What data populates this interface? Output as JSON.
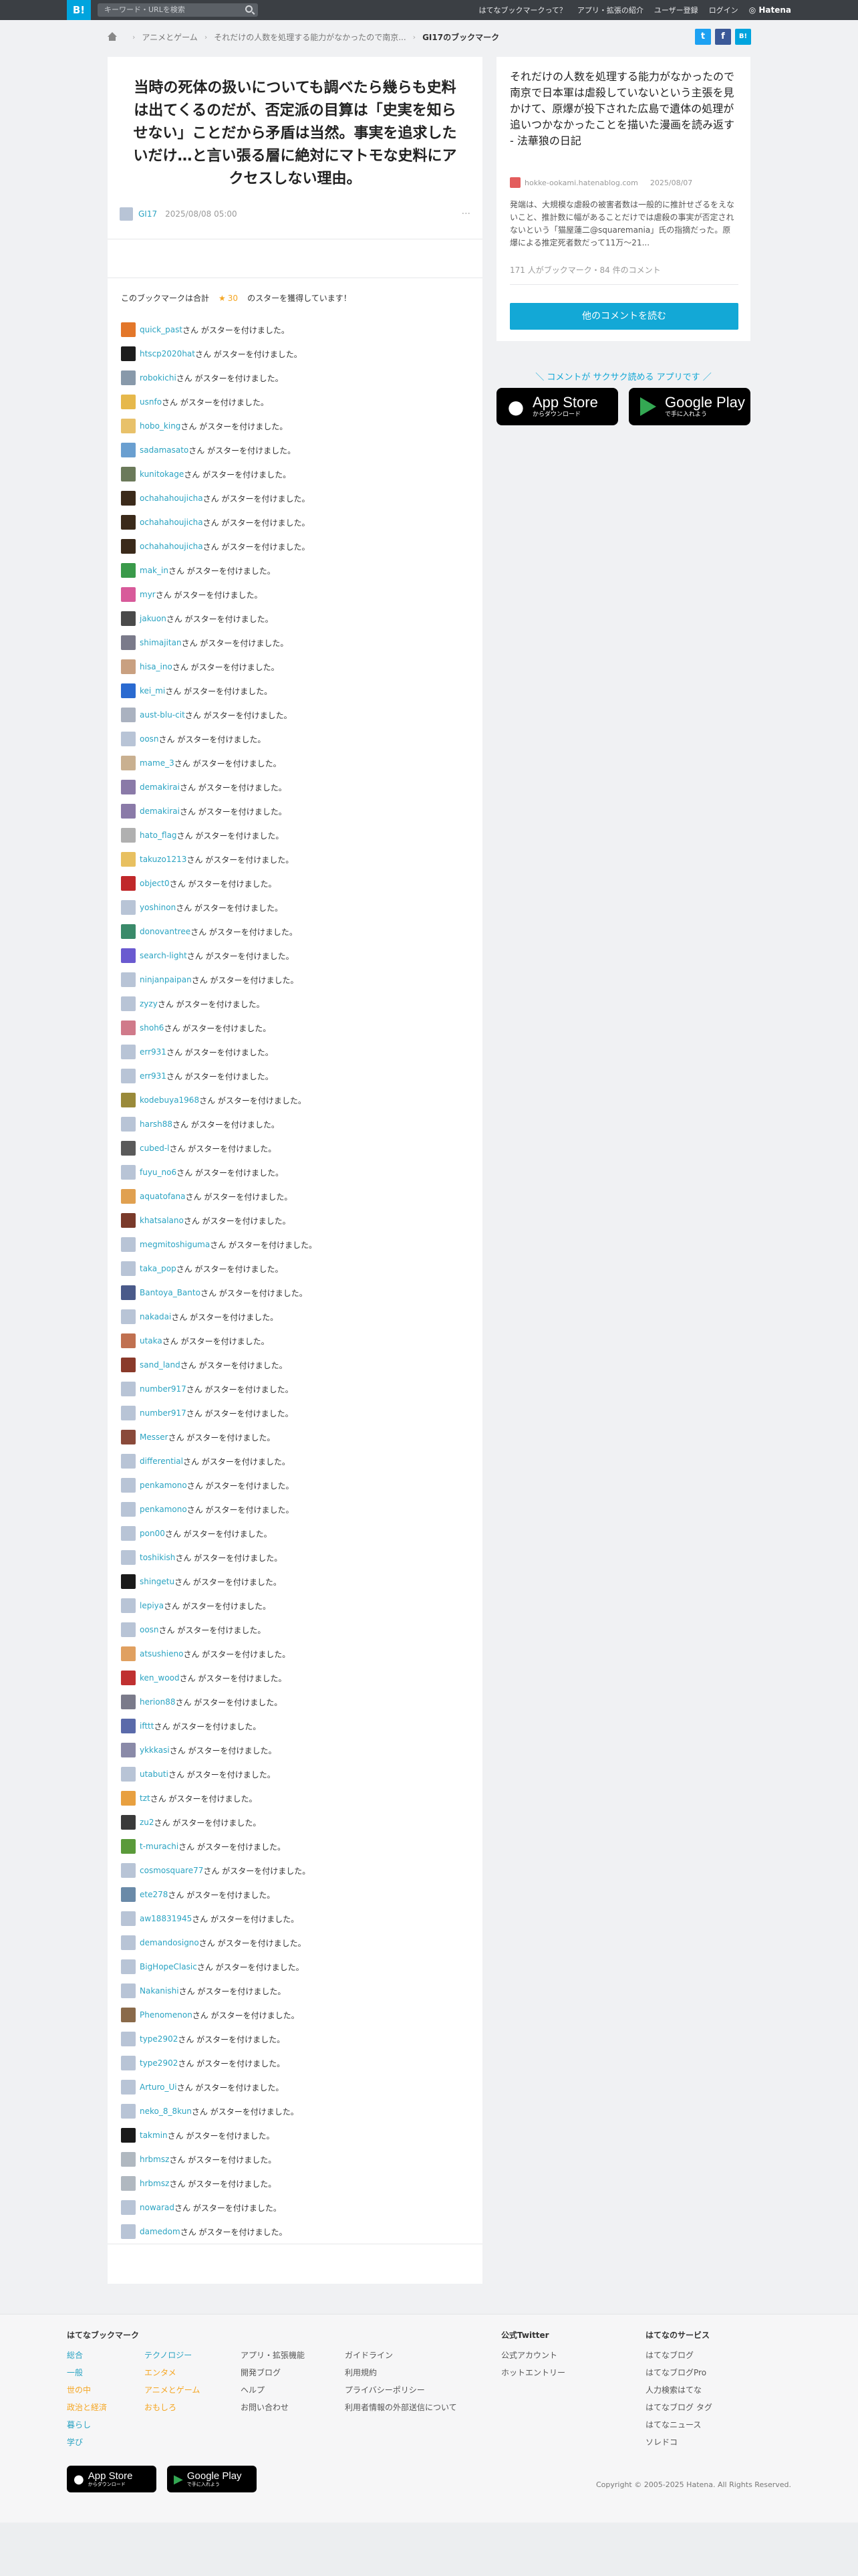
{
  "header": {
    "logo": "B!",
    "search_placeholder": "キーワード・URLを検索",
    "nav": [
      "はてなブックマークって？",
      "アプリ・拡張の紹介",
      "ユーザー登録",
      "ログイン"
    ],
    "brand": "Hatena"
  },
  "breadcrumb": {
    "items": [
      "アニメとゲーム",
      "それだけの人数を処理する能力がなかったので南京..."
    ],
    "current": "GI17のブックマーク"
  },
  "article": {
    "title": "当時の死体の扱いについても調べたら幾らも史料は出てくるのだが、否定派の目算は「史実を知らせない」ことだから矛盾は当然。事実を追求したいだけ…と言い張る層に絶対にマトモな史料にアクセスしない理由。",
    "user": "GI17",
    "date": "2025/08/08 05:00",
    "more": "···"
  },
  "stars": {
    "prefix": "このブックマークは合計",
    "star": "★",
    "count": "30",
    "suffix": "のスターを獲得しています！",
    "suffix_row": "さん がスターを付けました。",
    "users": [
      {
        "name": "quick_past",
        "color": "#e3772a"
      },
      {
        "name": "htscp2020hat",
        "color": "#1d1d1d"
      },
      {
        "name": "robokichi",
        "color": "#8899aa"
      },
      {
        "name": "usnfo",
        "color": "#e6b84b"
      },
      {
        "name": "hobo_king",
        "color": "#e8c16a"
      },
      {
        "name": "sadamasato",
        "color": "#6a9fd0"
      },
      {
        "name": "kunitokage",
        "color": "#6b7a5a"
      },
      {
        "name": "ochahahoujicha",
        "color": "#3b2a1a"
      },
      {
        "name": "ochahahoujicha",
        "color": "#3b2a1a"
      },
      {
        "name": "ochahahoujicha",
        "color": "#3b2a1a"
      },
      {
        "name": "mak_in",
        "color": "#3a9a4a"
      },
      {
        "name": "myr",
        "color": "#d85a9a"
      },
      {
        "name": "jakuon",
        "color": "#4a4a4a"
      },
      {
        "name": "shimajitan",
        "color": "#7a7a8a"
      },
      {
        "name": "hisa_ino",
        "color": "#c9a080"
      },
      {
        "name": "kei_mi",
        "color": "#2a6ad0"
      },
      {
        "name": "aust-blu-cit",
        "color": "#aab2c0"
      },
      {
        "name": "oosn",
        "color": "#b8c4d6"
      },
      {
        "name": "mame_3",
        "color": "#c9b090"
      },
      {
        "name": "demakirai",
        "color": "#8a7aa8"
      },
      {
        "name": "demakirai",
        "color": "#8a7aa8"
      },
      {
        "name": "hato_flag",
        "color": "#b0b0b0"
      },
      {
        "name": "takuzo1213",
        "color": "#e8c060"
      },
      {
        "name": "object0",
        "color": "#c0282a"
      },
      {
        "name": "yoshinon",
        "color": "#b8c4d6"
      },
      {
        "name": "donovantree",
        "color": "#3a8a6a"
      },
      {
        "name": "search-light",
        "color": "#6a5ad0"
      },
      {
        "name": "ninjanpaipan",
        "color": "#b8c4d6"
      },
      {
        "name": "zyzy",
        "color": "#b8c4d6"
      },
      {
        "name": "shoh6",
        "color": "#d07a8a"
      },
      {
        "name": "err931",
        "color": "#b8c4d6"
      },
      {
        "name": "err931",
        "color": "#b8c4d6"
      },
      {
        "name": "kodebuya1968",
        "color": "#9a8a3a"
      },
      {
        "name": "harsh88",
        "color": "#b8c4d6"
      },
      {
        "name": "cubed-l",
        "color": "#5a5a5a"
      },
      {
        "name": "fuyu_no6",
        "color": "#b8c4d6"
      },
      {
        "name": "aquatofana",
        "color": "#e0a050"
      },
      {
        "name": "khatsalano",
        "color": "#7a3a2a"
      },
      {
        "name": "megmitoshiguma",
        "color": "#b8c4d6"
      },
      {
        "name": "taka_pop",
        "color": "#b8c4d6"
      },
      {
        "name": "Bantoya_Banto",
        "color": "#4a5a8a"
      },
      {
        "name": "nakadai",
        "color": "#b8c4d6"
      },
      {
        "name": "utaka",
        "color": "#c07050"
      },
      {
        "name": "sand_land",
        "color": "#8a3a2a"
      },
      {
        "name": "number917",
        "color": "#b8c4d6"
      },
      {
        "name": "number917",
        "color": "#b8c4d6"
      },
      {
        "name": "Messer",
        "color": "#8a4a3a"
      },
      {
        "name": "differential",
        "color": "#b8c4d6"
      },
      {
        "name": "penkamono",
        "color": "#b8c4d6"
      },
      {
        "name": "penkamono",
        "color": "#b8c4d6"
      },
      {
        "name": "pon00",
        "color": "#b8c4d6"
      },
      {
        "name": "toshikish",
        "color": "#b8c4d6"
      },
      {
        "name": "shingetu",
        "color": "#1a1a1a"
      },
      {
        "name": "lepiya",
        "color": "#b8c4d6"
      },
      {
        "name": "oosn",
        "color": "#b8c4d6"
      },
      {
        "name": "atsushieno",
        "color": "#e0a060"
      },
      {
        "name": "ken_wood",
        "color": "#c03030"
      },
      {
        "name": "herion88",
        "color": "#7a7a8a"
      },
      {
        "name": "ifttt",
        "color": "#5a6aaa"
      },
      {
        "name": "ykkkasi",
        "color": "#8a8aa8"
      },
      {
        "name": "utabuti",
        "color": "#b8c4d6"
      },
      {
        "name": "tzt",
        "color": "#e8a040"
      },
      {
        "name": "zu2",
        "color": "#3a3a3a"
      },
      {
        "name": "t-murachi",
        "color": "#5a9a3a"
      },
      {
        "name": "cosmosquare77",
        "color": "#b8c4d6"
      },
      {
        "name": "ete278",
        "color": "#6a8aa8"
      },
      {
        "name": "aw18831945",
        "color": "#b8c4d6"
      },
      {
        "name": "demandosigno",
        "color": "#b8c4d6"
      },
      {
        "name": "BigHopeClasic",
        "color": "#b8c4d6"
      },
      {
        "name": "Nakanishi",
        "color": "#b8c4d6"
      },
      {
        "name": "Phenomenon",
        "color": "#8a6a4a"
      },
      {
        "name": "type2902",
        "color": "#b8c4d6"
      },
      {
        "name": "type2902",
        "color": "#b8c4d6"
      },
      {
        "name": "Arturo_Ui",
        "color": "#b8c4d6"
      },
      {
        "name": "neko_8_8kun",
        "color": "#b8c4d6"
      },
      {
        "name": "takmin",
        "color": "#1a1a1a"
      },
      {
        "name": "hrbmsz",
        "color": "#b0b8c0"
      },
      {
        "name": "hrbmsz",
        "color": "#b0b8c0"
      },
      {
        "name": "nowarad",
        "color": "#b8c4d6"
      },
      {
        "name": "damedom",
        "color": "#b8c4d6"
      }
    ]
  },
  "sidebar": {
    "title": "それだけの人数を処理する能力がなかったので南京で日本軍は虐殺していないという主張を見かけて、原爆が投下された広島で遺体の処理が追いつかなかったことを描いた漫画を読み返す - 法華狼の日記",
    "source": "hokke-ookami.hatenablog.com",
    "date": "2025/08/07",
    "description": "発端は、大規模な虐殺の被害者数は一般的に推計せざるをえないこと、推計数に幅があることだけでは虐殺の事実が否定されないという「猫屋蓮二@squaremania」氏の指摘だった。原爆による推定死者数だって11万〜21...",
    "counts": "171 人がブックマーク・84 件のコメント",
    "button": "他のコメントを読む"
  },
  "promo": {
    "text": "＼ コメントが サクサク読める アプリです ／",
    "appstore_small": "からダウンロード",
    "appstore_big": "App Store",
    "gplay_small": "で手に入れよう",
    "gplay_big": "Google Play"
  },
  "footer": {
    "col1_title": "はてなブックマーク",
    "col1_a": [
      "総合",
      "一般",
      "世の中",
      "政治と経済",
      "暮らし",
      "学び"
    ],
    "col1_b": [
      "テクノロジー",
      "エンタメ",
      "アニメとゲーム",
      "おもしろ"
    ],
    "col2": [
      "アプリ・拡張機能",
      "開発ブログ",
      "ヘルプ",
      "お問い合わせ"
    ],
    "col3": [
      "ガイドライン",
      "利用規約",
      "プライバシーポリシー",
      "利用者情報の外部送信について"
    ],
    "twitter_title": "公式Twitter",
    "twitter": [
      "公式アカウント",
      "ホットエントリー"
    ],
    "services_title": "はてなのサービス",
    "services": [
      "はてなブログ",
      "はてなブログPro",
      "人力検索はてな",
      "はてなブログ タグ",
      "はてなニュース",
      "ソレドコ"
    ],
    "copyright": "Copyright © 2005-2025 Hatena. All Rights Reserved."
  },
  "colors": {
    "accent": "#13a8d6",
    "link": "#2aa3c2",
    "star": "#f5a623",
    "header": "#3b3f44"
  }
}
